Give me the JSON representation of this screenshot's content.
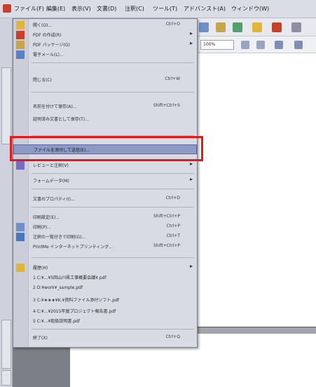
{
  "menubar": {
    "items": [
      "ファイル(F)",
      "編集(E)",
      "表示(V)",
      "文書(D)",
      "注釈(C)",
      "ツール(T)",
      "アドバンスト(A)",
      "ウィンドウ(W)"
    ]
  },
  "toolbar": {
    "zoom": "100%"
  },
  "file_menu": {
    "items": [
      {
        "id": "open",
        "label": "開く(O)...",
        "shortcut": "Ctrl+O"
      },
      {
        "id": "create-pdf",
        "label": "PDF の作成(R)",
        "shortcut": ""
      },
      {
        "id": "pdf-package",
        "label": "PDF パッケージ(G)",
        "shortcut": ""
      },
      {
        "id": "email",
        "label": "電子メール(L)...",
        "shortcut": ""
      },
      {
        "id": "close",
        "label": "閉じる(C)",
        "shortcut": "Ctrl+W"
      },
      {
        "id": "save-as",
        "label": "名前を付けて保存(A)...",
        "shortcut": "Shift+Ctrl+S"
      },
      {
        "id": "save-as-certified",
        "label": "証明済み文書として保存(T)...",
        "shortcut": ""
      },
      {
        "id": "attach-to-email",
        "label": "ファイルを添付して送信(E)...",
        "shortcut": ""
      },
      {
        "id": "review-comment",
        "label": "レビューと注釈(V)",
        "shortcut": ""
      },
      {
        "id": "form-data",
        "label": "フォームデータ(M)",
        "shortcut": ""
      },
      {
        "id": "document-properties",
        "label": "文書のプロパティ(I)...",
        "shortcut": "Ctrl+D"
      },
      {
        "id": "print-setup",
        "label": "印刷設定(E)...",
        "shortcut": "Shift+Ctrl+P"
      },
      {
        "id": "print",
        "label": "印刷(P)...",
        "shortcut": "Ctrl+P"
      },
      {
        "id": "print-with-comments",
        "label": "注釈の一覧付きで印刷(G)...",
        "shortcut": "Ctrl+T"
      },
      {
        "id": "printme",
        "label": "PrintMe インターネットプリンティング...",
        "shortcut": "Shift+Ctrl+P"
      },
      {
        "id": "history",
        "label": "履歴(H)",
        "shortcut": ""
      },
      {
        "id": "recent1",
        "label": "1 C:¥...¥5回山川県工事概要会議¥.pdf",
        "shortcut": ""
      },
      {
        "id": "recent2",
        "label": "2 D:¥work¥_sample.pdf",
        "shortcut": ""
      },
      {
        "id": "recent3",
        "label": "3 C:¥★★★¥K.¥資料ファイル添付ソフト.pdf",
        "shortcut": ""
      },
      {
        "id": "recent4",
        "label": "4 C:¥...¥2015年度プロジェクト報告書.pdf",
        "shortcut": ""
      },
      {
        "id": "recent5",
        "label": "5 C:¥...¥取扱説明書.pdf",
        "shortcut": ""
      },
      {
        "id": "exit",
        "label": "終了(X)",
        "shortcut": "Ctrl+Q"
      }
    ]
  },
  "colors": {
    "highlight": "#8e99c4",
    "annotation_frame": "#e3191d"
  }
}
